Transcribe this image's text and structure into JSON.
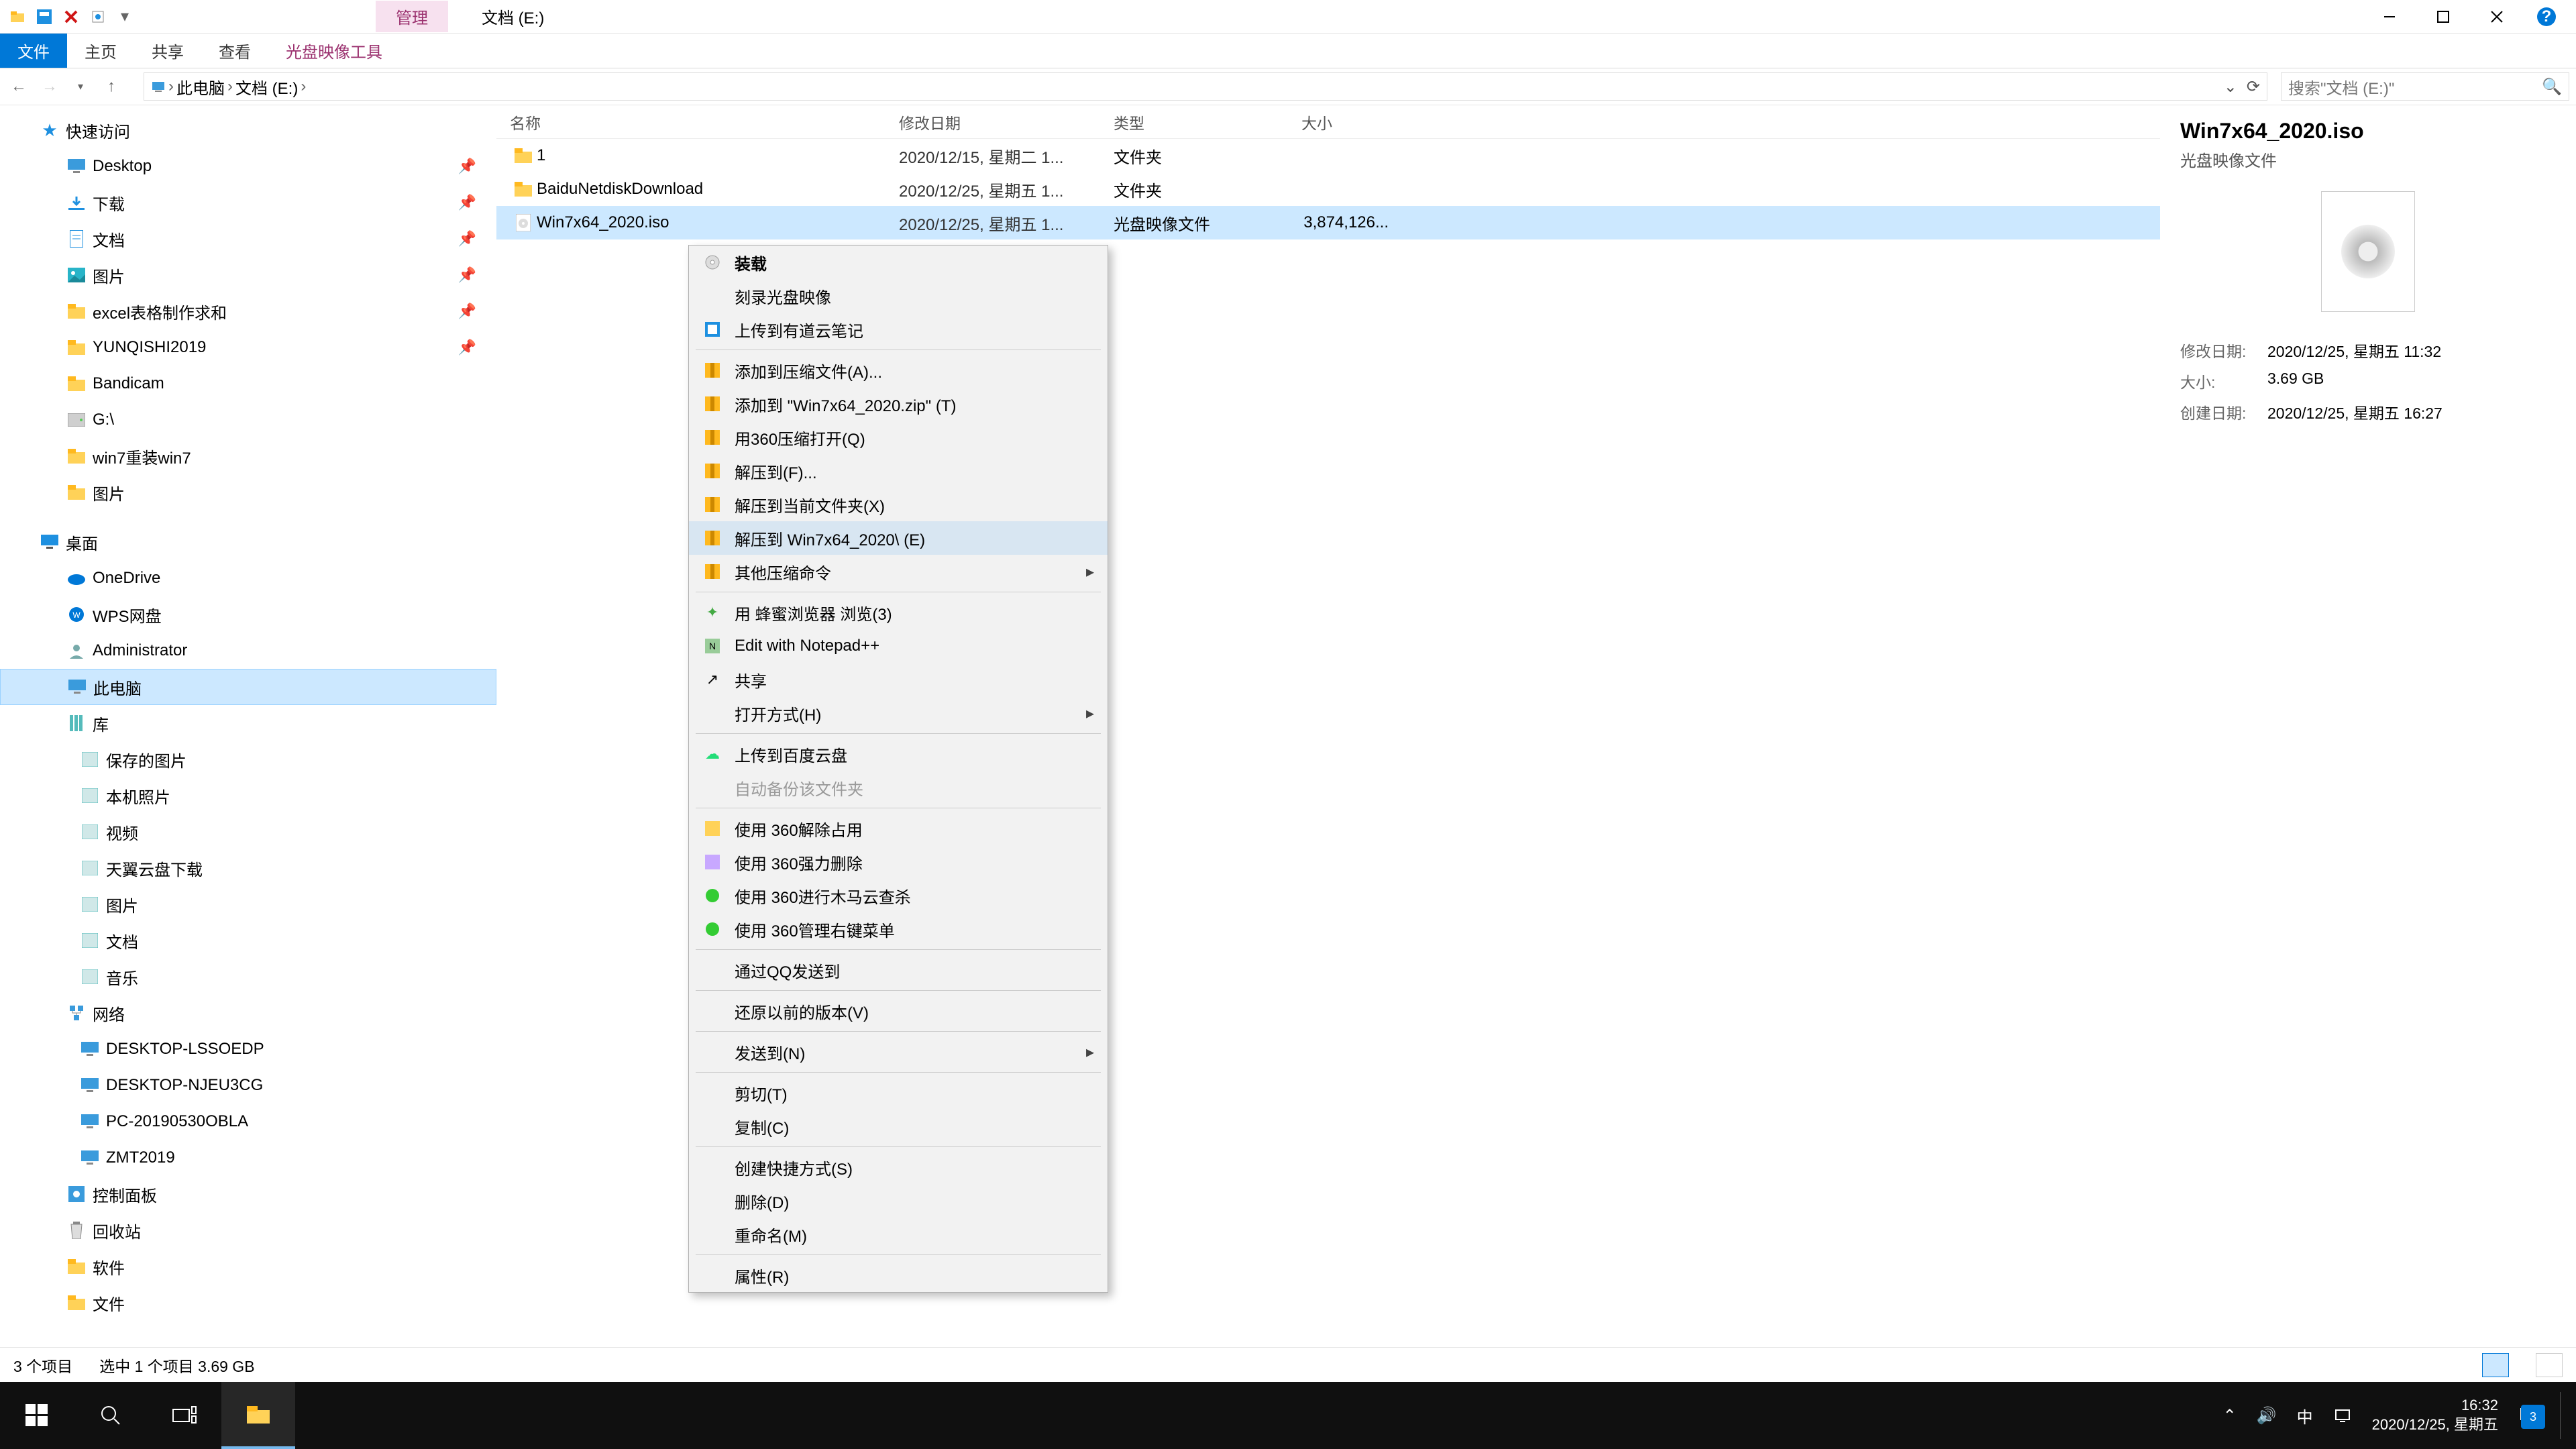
{
  "window": {
    "title": "文档 (E:)",
    "ribbon_context_tag": "管理"
  },
  "ribbon": {
    "tabs": [
      "文件",
      "主页",
      "共享",
      "查看"
    ],
    "context_tab": "光盘映像工具"
  },
  "breadcrumb": {
    "segments": [
      "此电脑",
      "文档 (E:)"
    ]
  },
  "search": {
    "placeholder": "搜索\"文档 (E:)\""
  },
  "tree": {
    "quick": {
      "label": "快速访问",
      "items": [
        {
          "label": "Desktop",
          "icon": "desktop",
          "pinned": true
        },
        {
          "label": "下载",
          "icon": "download",
          "pinned": true
        },
        {
          "label": "文档",
          "icon": "document",
          "pinned": true
        },
        {
          "label": "图片",
          "icon": "picture",
          "pinned": true
        },
        {
          "label": "excel表格制作求和",
          "icon": "folder",
          "pinned": true
        },
        {
          "label": "YUNQISHI2019",
          "icon": "folder",
          "pinned": true
        },
        {
          "label": "Bandicam",
          "icon": "folder"
        },
        {
          "label": "G:\\",
          "icon": "drive"
        },
        {
          "label": "win7重装win7",
          "icon": "folder"
        },
        {
          "label": "图片",
          "icon": "folder"
        }
      ]
    },
    "desktop": {
      "label": "桌面",
      "items": [
        {
          "label": "OneDrive",
          "icon": "cloud"
        },
        {
          "label": "WPS网盘",
          "icon": "wps"
        },
        {
          "label": "Administrator",
          "icon": "user"
        },
        {
          "label": "此电脑",
          "icon": "pc",
          "selected": true
        },
        {
          "label": "库",
          "icon": "library",
          "items": [
            {
              "label": "保存的图片",
              "icon": "libitem"
            },
            {
              "label": "本机照片",
              "icon": "libitem"
            },
            {
              "label": "视频",
              "icon": "libitem"
            },
            {
              "label": "天翼云盘下载",
              "icon": "libitem"
            },
            {
              "label": "图片",
              "icon": "libitem"
            },
            {
              "label": "文档",
              "icon": "libitem"
            },
            {
              "label": "音乐",
              "icon": "libitem"
            }
          ]
        },
        {
          "label": "网络",
          "icon": "network",
          "items": [
            {
              "label": "DESKTOP-LSSOEDP",
              "icon": "pc"
            },
            {
              "label": "DESKTOP-NJEU3CG",
              "icon": "pc"
            },
            {
              "label": "PC-20190530OBLA",
              "icon": "pc"
            },
            {
              "label": "ZMT2019",
              "icon": "pc"
            }
          ]
        },
        {
          "label": "控制面板",
          "icon": "cp"
        },
        {
          "label": "回收站",
          "icon": "bin"
        },
        {
          "label": "软件",
          "icon": "folder"
        },
        {
          "label": "文件",
          "icon": "folder"
        }
      ]
    }
  },
  "columns": {
    "name": "名称",
    "date": "修改日期",
    "type": "类型",
    "size": "大小"
  },
  "files": [
    {
      "name": "1",
      "date": "2020/12/15, 星期二 1...",
      "type": "文件夹",
      "size": "",
      "icon": "folder"
    },
    {
      "name": "BaiduNetdiskDownload",
      "date": "2020/12/25, 星期五 1...",
      "type": "文件夹",
      "size": "",
      "icon": "folder"
    },
    {
      "name": "Win7x64_2020.iso",
      "date": "2020/12/25, 星期五 1...",
      "type": "光盘映像文件",
      "size": "3,874,126...",
      "icon": "iso",
      "selected": true
    }
  ],
  "preview": {
    "title": "Win7x64_2020.iso",
    "subtitle": "光盘映像文件",
    "rows": [
      {
        "label": "修改日期:",
        "value": "2020/12/25, 星期五 11:32"
      },
      {
        "label": "大小:",
        "value": "3.69 GB"
      },
      {
        "label": "创建日期:",
        "value": "2020/12/25, 星期五 16:27"
      }
    ]
  },
  "status": {
    "count": "3 个项目",
    "selection": "选中 1 个项目  3.69 GB"
  },
  "context_menu": [
    {
      "label": "装载",
      "icon": "disc",
      "bold": true
    },
    {
      "label": "刻录光盘映像"
    },
    {
      "label": "上传到有道云笔记",
      "icon": "note"
    },
    {
      "sep": true
    },
    {
      "label": "添加到压缩文件(A)...",
      "icon": "zip"
    },
    {
      "label": "添加到 \"Win7x64_2020.zip\" (T)",
      "icon": "zip"
    },
    {
      "label": "用360压缩打开(Q)",
      "icon": "zip"
    },
    {
      "label": "解压到(F)...",
      "icon": "zip"
    },
    {
      "label": "解压到当前文件夹(X)",
      "icon": "zip"
    },
    {
      "label": "解压到 Win7x64_2020\\ (E)",
      "icon": "zip",
      "hover": true
    },
    {
      "label": "其他压缩命令",
      "icon": "zip",
      "arrow": true
    },
    {
      "sep": true
    },
    {
      "label": "用 蜂蜜浏览器 浏览(3)",
      "icon": "bee"
    },
    {
      "label": "Edit with Notepad++",
      "icon": "npp"
    },
    {
      "label": "共享",
      "icon": "share"
    },
    {
      "label": "打开方式(H)",
      "arrow": true
    },
    {
      "sep": true
    },
    {
      "label": "上传到百度云盘",
      "icon": "baidu"
    },
    {
      "label": "自动备份该文件夹",
      "disabled": true
    },
    {
      "sep": true
    },
    {
      "label": "使用 360解除占用",
      "icon": "360y"
    },
    {
      "label": "使用 360强力删除",
      "icon": "360d"
    },
    {
      "label": "使用 360进行木马云查杀",
      "icon": "360g"
    },
    {
      "label": "使用 360管理右键菜单",
      "icon": "360g"
    },
    {
      "sep": true
    },
    {
      "label": "通过QQ发送到"
    },
    {
      "sep": true
    },
    {
      "label": "还原以前的版本(V)"
    },
    {
      "sep": true
    },
    {
      "label": "发送到(N)",
      "arrow": true
    },
    {
      "sep": true
    },
    {
      "label": "剪切(T)"
    },
    {
      "label": "复制(C)"
    },
    {
      "sep": true
    },
    {
      "label": "创建快捷方式(S)"
    },
    {
      "label": "删除(D)"
    },
    {
      "label": "重命名(M)"
    },
    {
      "sep": true
    },
    {
      "label": "属性(R)"
    }
  ],
  "taskbar": {
    "time": "16:32",
    "date": "2020/12/25, 星期五",
    "ime": "中",
    "notif": "3"
  }
}
